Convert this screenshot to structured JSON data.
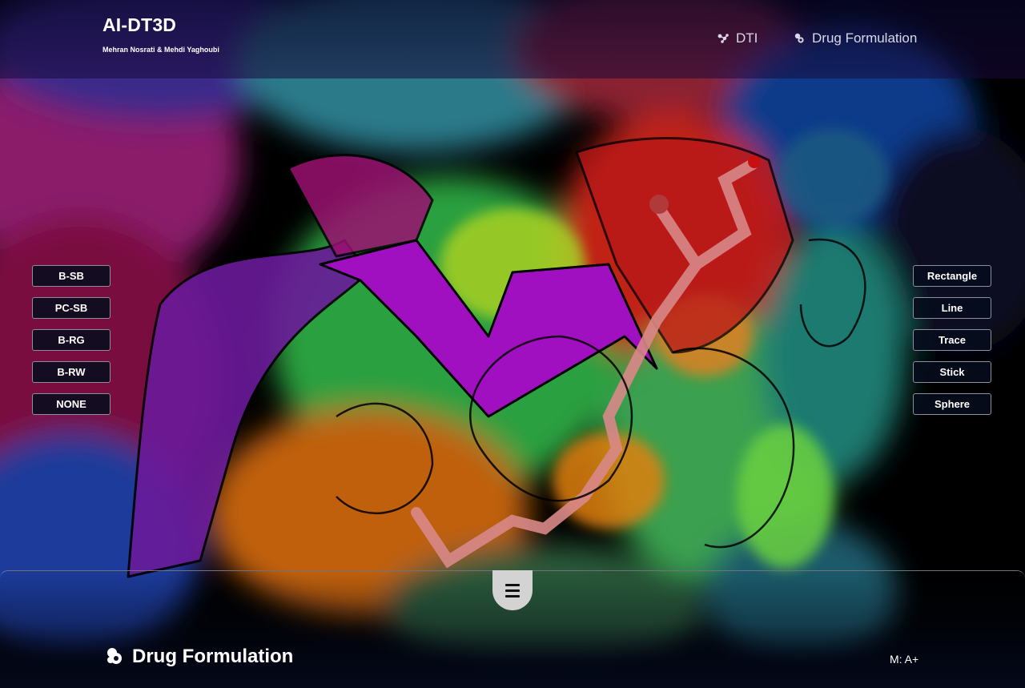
{
  "app": {
    "title": "AI-DT3D",
    "authors": "Mehran Nosrati & Mehdi Yaghoubi"
  },
  "nav": {
    "dti_label": "DTI",
    "dti_icon": "molecule-icon",
    "drug_formulation_label": "Drug Formulation",
    "drug_formulation_icon": "pills-icon"
  },
  "color_schemes": {
    "buttons": [
      "B-SB",
      "PC-SB",
      "B-RG",
      "B-RW",
      "NONE"
    ]
  },
  "representations": {
    "buttons": [
      "Rectangle",
      "Line",
      "Trace",
      "Stick",
      "Sphere"
    ]
  },
  "bottom_panel": {
    "toggle_icon": "hamburger-menu-icon",
    "title": "Drug Formulation",
    "title_icon": "pills-icon",
    "mode_readout": "M: A+"
  },
  "colors": {
    "header_bg": "#0b0830",
    "button_bg": "#060c1c",
    "button_border": "#8d8f9a",
    "panel_bg": "#040818",
    "toggle_bg": "#d3d3d3"
  }
}
